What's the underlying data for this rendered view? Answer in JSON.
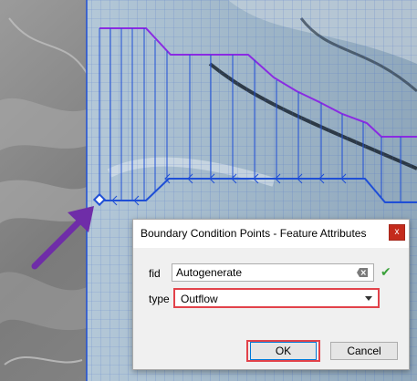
{
  "dialog": {
    "title": "Boundary Condition Points - Feature Attributes",
    "close_glyph": "x",
    "fields": {
      "fid": {
        "label": "fid",
        "value": "Autogenerate"
      },
      "type": {
        "label": "type",
        "value": "Outflow"
      }
    },
    "buttons": {
      "ok": "OK",
      "cancel": "Cancel"
    }
  },
  "colors": {
    "grid_line": "#1f4fd6",
    "profile_line": "#8a2be2",
    "arrow": "#6f2da8",
    "highlight": "#e2424a",
    "valid_check": "#3aa13a"
  },
  "icons": {
    "clear": "clear-input-icon",
    "valid": "checkmark-icon",
    "dropdown": "chevron-down-icon",
    "point": "boundary-point-marker-icon",
    "arrow": "pointer-arrow-icon"
  }
}
